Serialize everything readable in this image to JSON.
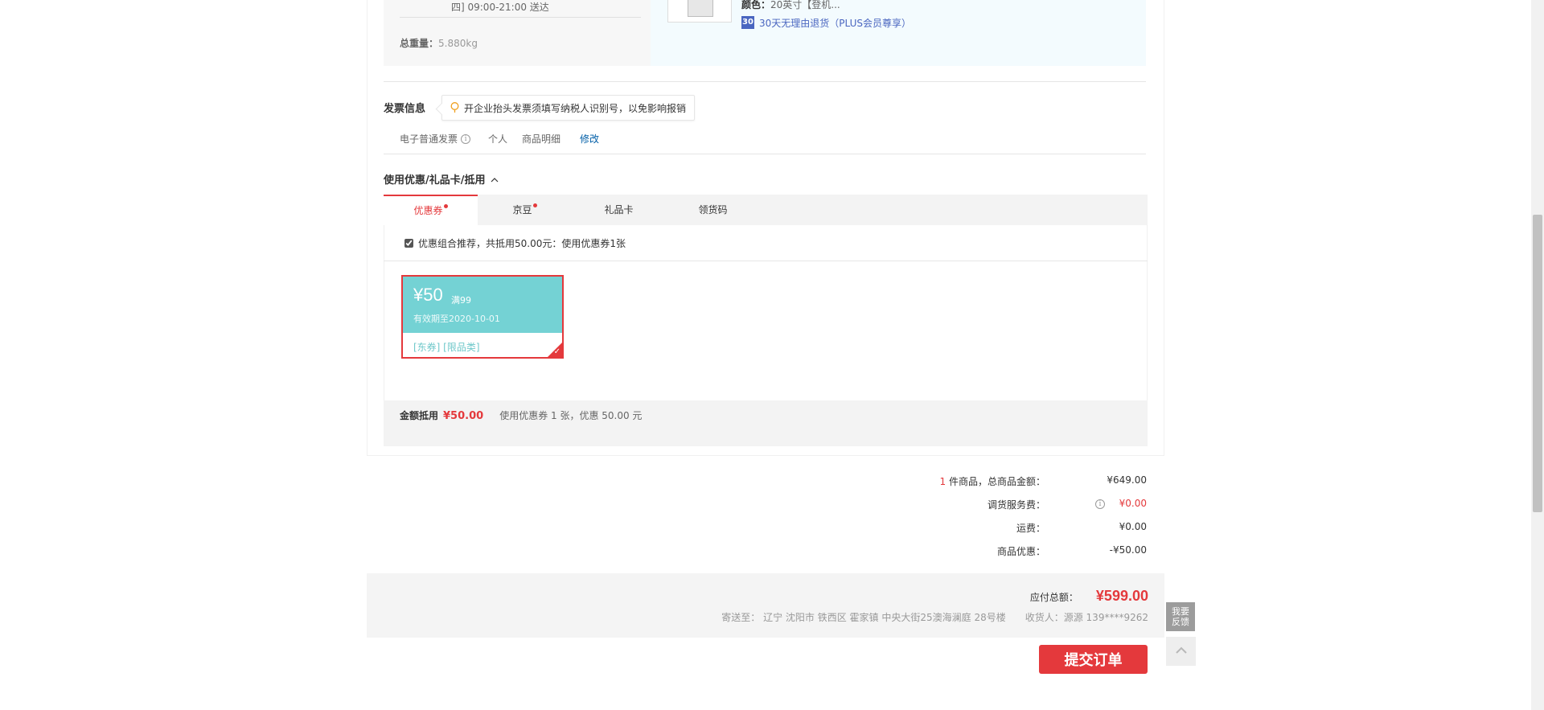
{
  "shipping": {
    "time_text": "四] 09:00-21:00 送达",
    "weight_label": "总重量：",
    "weight_value": "5.880kg"
  },
  "product": {
    "color_label": "颜色：",
    "color_value": "20英寸【登机...",
    "return_badge": "30",
    "return_text": "30天无理由退货（PLUS会员尊享）"
  },
  "invoice": {
    "title": "发票信息",
    "tip": "开企业抬头发票须填写纳税人识别号，以免影响报销",
    "type": "电子普通发票",
    "title_type": "个人",
    "content": "商品明细",
    "edit": "修改"
  },
  "coupon_section": {
    "title": "使用优惠/礼品卡/抵用",
    "tabs": [
      {
        "label": "优惠券",
        "dot": true
      },
      {
        "label": "京豆",
        "dot": true
      },
      {
        "label": "礼品卡",
        "dot": false
      },
      {
        "label": "领货码",
        "dot": false
      }
    ],
    "combo_text": "优惠组合推荐，共抵用50.00元：使用优惠券1张",
    "coupon": {
      "amount": "¥50",
      "condition": "满99",
      "valid": "有效期至2020-10-01",
      "tags": "[东券] [限品类]"
    },
    "deduct_label": "金额抵用",
    "deduct_amount": "¥50.00",
    "deduct_desc": "使用优惠券 1 张，优惠 50.00 元"
  },
  "summary": {
    "count": "1",
    "count_suffix": " 件商品，总商品金额：",
    "goods_amount": "¥649.00",
    "service_label": "调货服务费：",
    "service_amount": "¥0.00",
    "freight_label": "运费：",
    "freight_amount": "¥0.00",
    "discount_label": "商品优惠：",
    "discount_amount": "-¥50.00"
  },
  "total": {
    "label": "应付总额：",
    "amount": "¥599.00",
    "address": "寄送至： 辽宁 沈阳市 铁西区 霍家镇 中央大街25澳海澜庭 28号楼",
    "receiver": "收货人：源源 139****9262"
  },
  "submit_label": "提交订单",
  "tools": {
    "feedback_line1": "我要",
    "feedback_line2": "反馈"
  },
  "colors": {
    "accent": "#e4393c",
    "coupon_bg": "#74d2d4",
    "link": "#005ea7"
  }
}
